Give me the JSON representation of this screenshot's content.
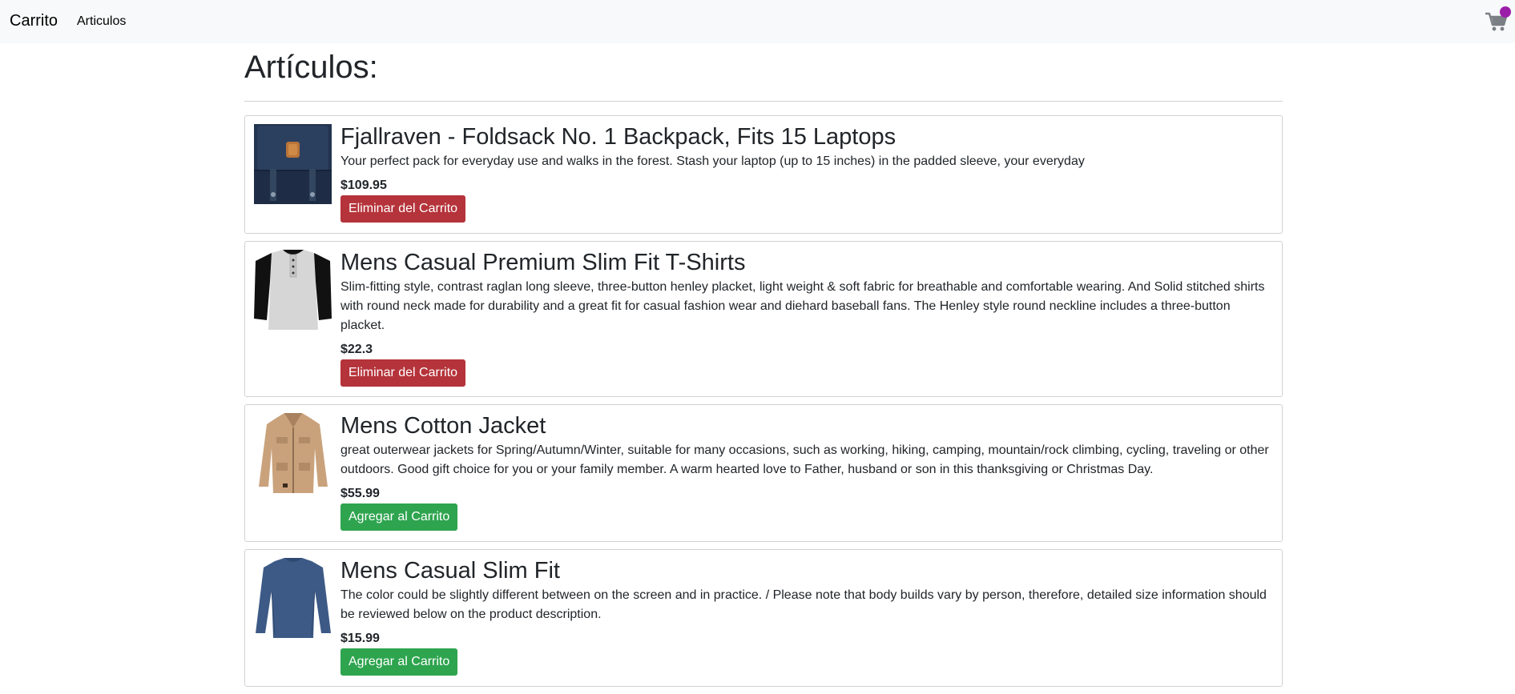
{
  "navbar": {
    "brand": "Carrito",
    "link": "Articulos",
    "colors": {
      "background": "#f8f9fa",
      "badge": "#9b1ea8"
    },
    "cart_icon": "shopping-cart-icon"
  },
  "page": {
    "heading": "Artículos:"
  },
  "products": [
    {
      "title": "Fjallraven - Foldsack No. 1 Backpack, Fits 15 Laptops",
      "description": "Your perfect pack for everyday use and walks in the forest. Stash your laptop (up to 15 inches) in the padded sleeve, your everyday",
      "price": "$109.95",
      "button_label": "Eliminar del Carrito",
      "button_type": "remove",
      "image": "backpack-image"
    },
    {
      "title": "Mens Casual Premium Slim Fit T-Shirts",
      "description": "Slim-fitting style, contrast raglan long sleeve, three-button henley placket, light weight & soft fabric for breathable and comfortable wearing. And Solid stitched shirts with round neck made for durability and a great fit for casual fashion wear and diehard baseball fans. The Henley style round neckline includes a three-button placket.",
      "price": "$22.3",
      "button_label": "Eliminar del Carrito",
      "button_type": "remove",
      "image": "tshirt-image"
    },
    {
      "title": "Mens Cotton Jacket",
      "description": "great outerwear jackets for Spring/Autumn/Winter, suitable for many occasions, such as working, hiking, camping, mountain/rock climbing, cycling, traveling or other outdoors. Good gift choice for you or your family member. A warm hearted love to Father, husband or son in this thanksgiving or Christmas Day.",
      "price": "$55.99",
      "button_label": "Agregar al Carrito",
      "button_type": "add",
      "image": "jacket-image"
    },
    {
      "title": "Mens Casual Slim Fit",
      "description": "The color could be slightly different between on the screen and in practice. / Please note that body builds vary by person, therefore, detailed size information should be reviewed below on the product description.",
      "price": "$15.99",
      "button_label": "Agregar al Carrito",
      "button_type": "add",
      "image": "longsleeve-image"
    }
  ],
  "colors": {
    "remove_button": "#b5333a",
    "add_button": "#2ea44f",
    "text": "#212529"
  }
}
